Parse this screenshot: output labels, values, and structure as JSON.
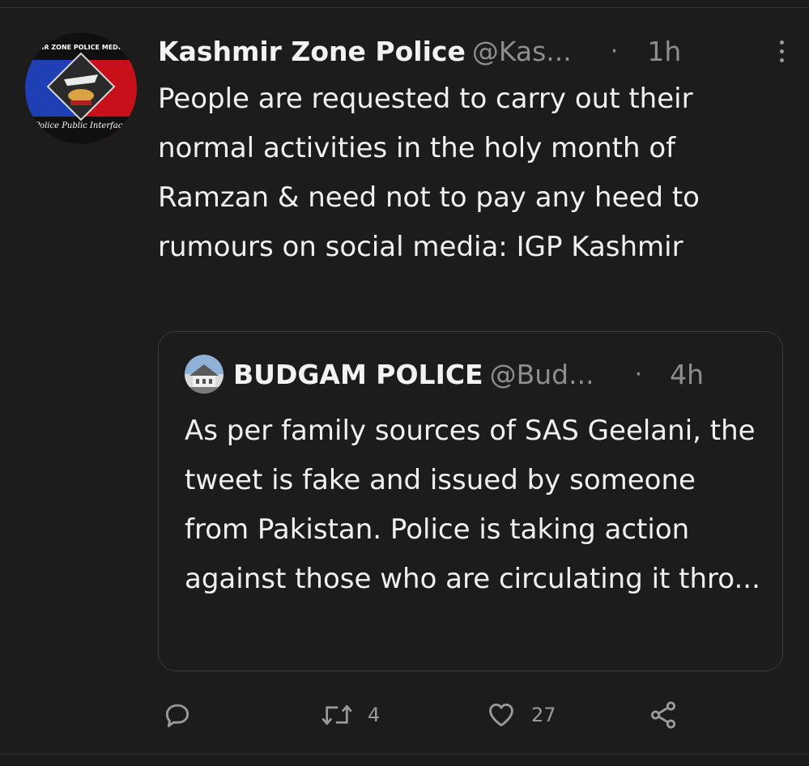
{
  "tweet": {
    "author_name": "Kashmir Zone Police",
    "author_handle": "@Kas...",
    "separator": "·",
    "time": "1h",
    "avatar": {
      "top_text": "SHMIR ZONE POLICE MEDIA CEN",
      "bottom_text": "Police Public Interface"
    },
    "text": "People are requested to carry out their normal activities in the holy month of Ramzan & need not to pay any heed to rumours on social media: IGP Kashmir"
  },
  "quote": {
    "author_name": "BUDGAM POLICE",
    "author_handle": "@Bud...",
    "separator": "·",
    "time": "4h",
    "text": "As per family sources of SAS Geelani, the tweet is fake and issued by someone from Pakistan. Police is taking action against those who are circulating it thro..."
  },
  "actions": {
    "reply_count": "",
    "retweet_count": "4",
    "like_count": "27"
  },
  "icons": {
    "more": "more-vert-icon",
    "reply": "reply-icon",
    "retweet": "retweet-icon",
    "like": "heart-icon",
    "share": "share-icon"
  },
  "colors": {
    "background": "#1c1c1c",
    "text": "#f0f0f0",
    "secondary_text": "#8e8e8e",
    "border": "#3a3a3a"
  }
}
